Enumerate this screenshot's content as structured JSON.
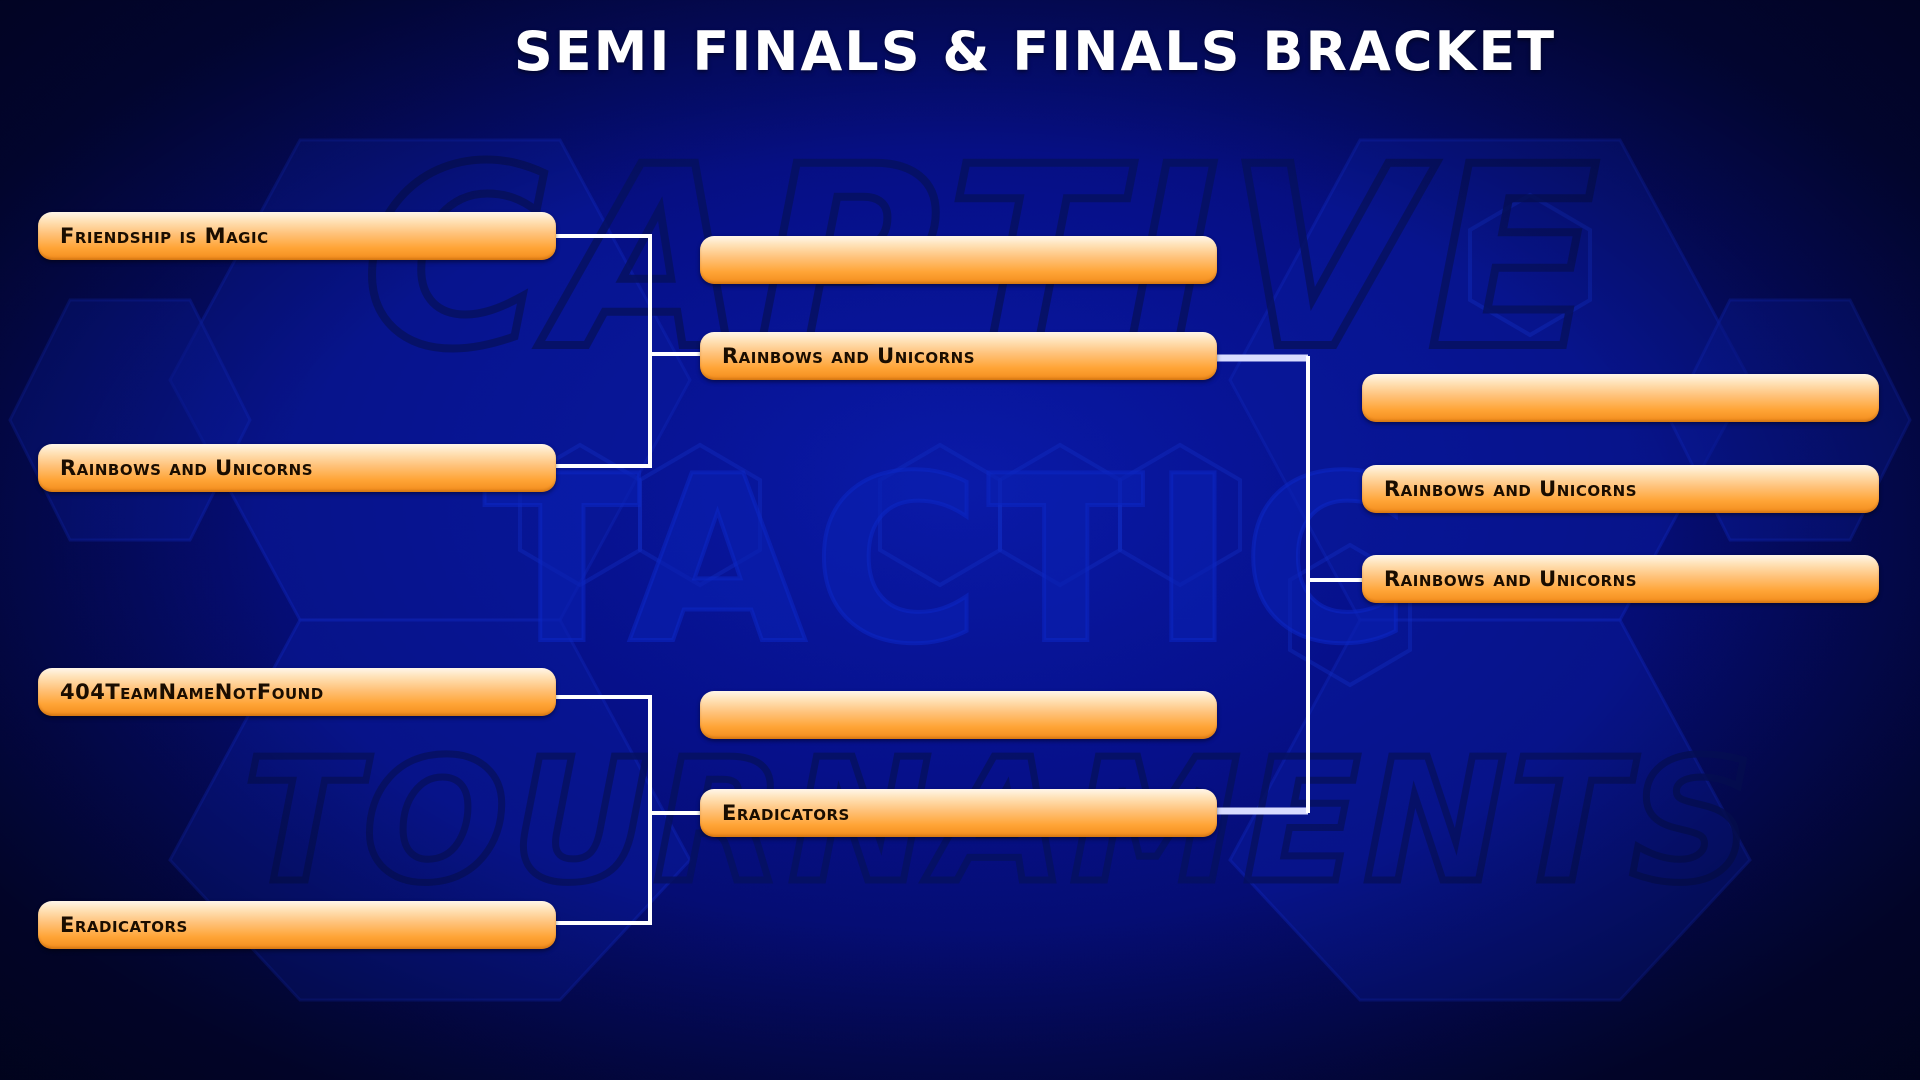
{
  "title": "SEMI FINALS & FINALS BRACKET",
  "watermark": {
    "line1": "CAPTIVE",
    "line2": "TACTIC",
    "line3": "TOURNAMENTS"
  },
  "colors": {
    "background": "#06108a",
    "slot_top": "#fff6ea",
    "slot_bottom": "#f28c1c",
    "connector": "#ffffff"
  },
  "semifinals": [
    {
      "team": "Friendship is Magic"
    },
    {
      "team": "Rainbows and Unicorns"
    },
    {
      "team": "404TeamNameNotFound"
    },
    {
      "team": "Eradicators"
    }
  ],
  "round2": [
    {
      "team": ""
    },
    {
      "team": "Rainbows and Unicorns"
    },
    {
      "team": ""
    },
    {
      "team": "Eradicators"
    }
  ],
  "finals": [
    {
      "team": ""
    },
    {
      "team": "Rainbows and Unicorns"
    },
    {
      "team": "Rainbows and Unicorns"
    }
  ]
}
